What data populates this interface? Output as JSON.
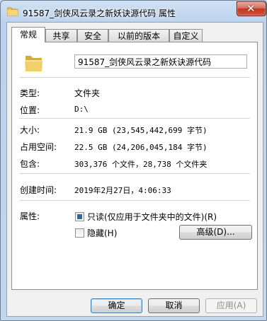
{
  "window": {
    "title": "91587_剑侠风云录之新妖诀源代码 属性",
    "close_symbol": "✕"
  },
  "tabs": [
    {
      "label": "常规",
      "active": true
    },
    {
      "label": "共享",
      "active": false
    },
    {
      "label": "安全",
      "active": false
    },
    {
      "label": "以前的版本",
      "active": false
    },
    {
      "label": "自定义",
      "active": false
    }
  ],
  "general": {
    "name_value": "91587_剑侠风云录之新妖诀源代码",
    "type_label": "类型:",
    "type_value": "文件夹",
    "location_label": "位置:",
    "location_value": "D:\\",
    "size_label": "大小:",
    "size_value": "21.9 GB (23,545,442,699 字节)",
    "size_on_disk_label": "占用空间:",
    "size_on_disk_value": "22.5 GB (24,206,045,184 字节)",
    "contains_label": "包含:",
    "contains_value": "303,376 个文件，28,738 个文件夹",
    "created_label": "创建时间:",
    "created_value": "2019年2月27日，4:06:33",
    "attributes_label": "属性:",
    "readonly_label": "只读(仅应用于文件夹中的文件)(R)",
    "readonly_state": "indeterminate",
    "hidden_label": "隐藏(H)",
    "hidden_checked": false,
    "advanced_label": "高级(D)..."
  },
  "footer": {
    "ok_label": "确定",
    "cancel_label": "取消",
    "apply_label": "应用(A)"
  },
  "colors": {
    "titlebar": "#c9d9ee",
    "close_button": "#c0351f",
    "checkbox_fill": "#3165a8",
    "folder": "#e8c15a"
  }
}
